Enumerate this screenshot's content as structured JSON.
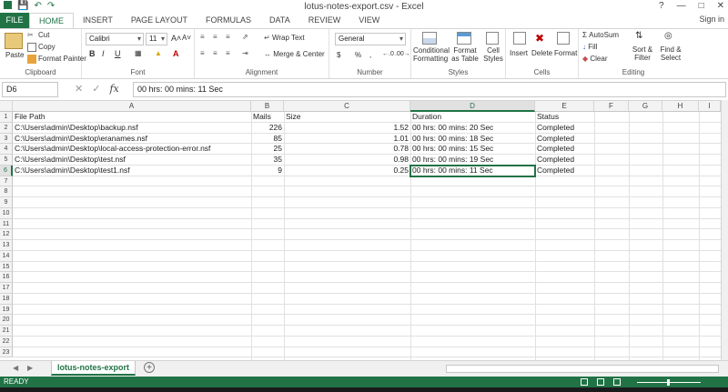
{
  "window": {
    "title": "lotus-notes-export.csv - Excel",
    "sign_in": "Sign in",
    "help": "?"
  },
  "ribbon_tabs": [
    "FILE",
    "HOME",
    "INSERT",
    "PAGE LAYOUT",
    "FORMULAS",
    "DATA",
    "REVIEW",
    "VIEW"
  ],
  "ribbon": {
    "clipboard": {
      "paste": "Paste",
      "cut": "Cut",
      "copy": "Copy",
      "format_painter": "Format Painter",
      "label": "Clipboard"
    },
    "font": {
      "name": "Calibri",
      "size": "11",
      "bold": "B",
      "italic": "I",
      "underline": "U",
      "label": "Font"
    },
    "alignment": {
      "wrap": "Wrap Text",
      "merge": "Merge & Center",
      "label": "Alignment"
    },
    "number": {
      "format": "General",
      "currency": "$",
      "percent": "%",
      "comma": ",",
      "label": "Number"
    },
    "styles": {
      "conditional": "Conditional Formatting",
      "format_table": "Format as Table",
      "cell_styles": "Cell Styles",
      "label": "Styles"
    },
    "cells": {
      "insert": "Insert",
      "delete": "Delete",
      "format": "Format",
      "label": "Cells"
    },
    "editing": {
      "autosum": "AutoSum",
      "fill": "Fill",
      "clear": "Clear",
      "sort": "Sort & Filter",
      "find": "Find & Select",
      "label": "Editing"
    }
  },
  "formula_bar": {
    "name_box": "D6",
    "fx": "fx",
    "value": "00 hrs: 00 mins: 11 Sec"
  },
  "columns": [
    "A",
    "B",
    "C",
    "D",
    "E",
    "F",
    "G",
    "H",
    "I"
  ],
  "rows": [
    [
      "File Path",
      "Mails",
      "Size",
      "Duration",
      "Status"
    ],
    [
      "C:\\Users\\admin\\Desktop\\backup.nsf",
      "226",
      "1.52",
      "00 hrs: 00 mins: 20 Sec",
      "Completed"
    ],
    [
      "C:\\Users\\admin\\Desktop\\eranames.nsf",
      "85",
      "1.01",
      "00 hrs: 00 mins: 18 Sec",
      "Completed"
    ],
    [
      "C:\\Users\\admin\\Desktop\\local-access-protection-error.nsf",
      "25",
      "0.78",
      "00 hrs: 00 mins: 15 Sec",
      "Completed"
    ],
    [
      "C:\\Users\\admin\\Desktop\\test.nsf",
      "35",
      "0.98",
      "00 hrs: 00 mins: 19 Sec",
      "Completed"
    ],
    [
      "C:\\Users\\admin\\Desktop\\test1.nsf",
      "9",
      "0.25",
      "00 hrs: 00 mins: 11 Sec",
      "Completed"
    ]
  ],
  "row_numbers": [
    "1",
    "2",
    "3",
    "4",
    "5",
    "6",
    "7",
    "8",
    "9",
    "10",
    "11",
    "12",
    "13",
    "14",
    "15",
    "16",
    "17",
    "18",
    "19",
    "20",
    "21",
    "22",
    "23"
  ],
  "sheet": {
    "name": "lotus-notes-export",
    "add": "+"
  },
  "status": {
    "text": "READY"
  },
  "accent_color": "#217346"
}
